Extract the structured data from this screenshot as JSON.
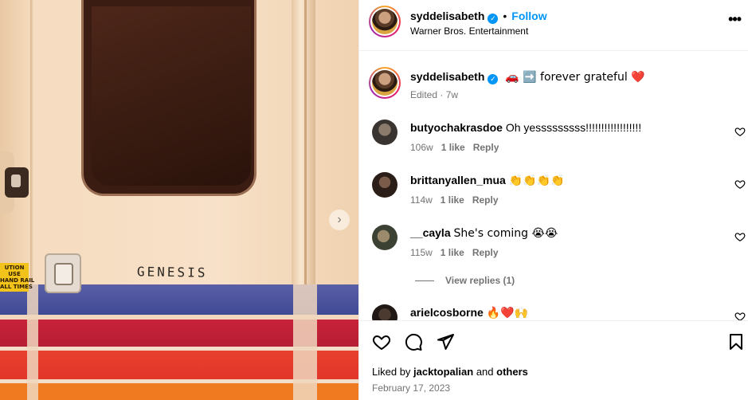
{
  "media": {
    "door_text": "GENESIS",
    "caution_text": "UTION\nUSE\nHAND RAIL\nALL TIMES"
  },
  "header": {
    "username": "syddelisabeth",
    "separator": "•",
    "follow_label": "Follow",
    "subtitle": "Warner Bros. Entertainment",
    "more_label": "•••"
  },
  "caption": {
    "username": "syddelisabeth",
    "text": "🚗 ➡️ forever grateful ❤️",
    "meta": "Edited · 7w"
  },
  "comments": [
    {
      "username": "butyochakrasdoe",
      "text": "Oh yesssssssss!!!!!!!!!!!!!!!!!!",
      "age": "106w",
      "likes": "1 like",
      "reply": "Reply"
    },
    {
      "username": "brittanyallen_mua",
      "text": "👏👏👏👏",
      "age": "114w",
      "likes": "1 like",
      "reply": "Reply"
    },
    {
      "username": "__cayla",
      "text": "She's coming 😭😭",
      "age": "115w",
      "likes": "1 like",
      "reply": "Reply"
    },
    {
      "username": "arielcosborne",
      "text": "🔥❤️🙌"
    }
  ],
  "view_replies": "View replies (1)",
  "footer": {
    "liked_prefix": "Liked by",
    "liked_user": "jacktopalian",
    "liked_and": "and",
    "liked_others": "others",
    "date": "February 17, 2023"
  },
  "colors": {
    "accent": "#0095f6",
    "meta_gray": "#737373",
    "stripe_blue": "#4a519c",
    "stripe_red": "#c8233a",
    "stripe_orange": "#f07a1f"
  }
}
